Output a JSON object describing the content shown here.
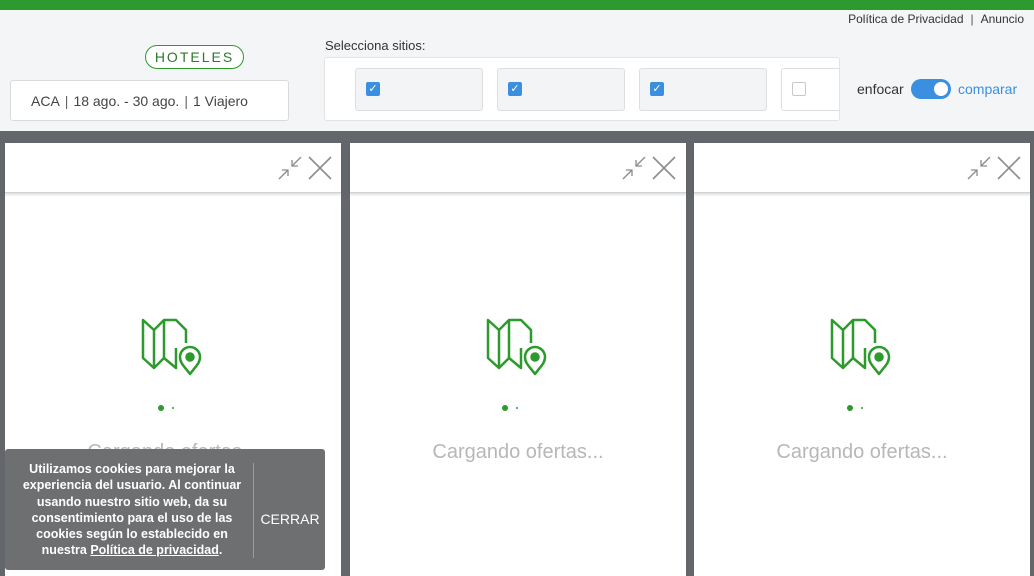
{
  "header": {
    "links": {
      "privacy": "Política de Privacidad",
      "separator": "|",
      "ad": "Anuncio"
    },
    "category_pill": "HOTELES",
    "search": {
      "destination": "ACA",
      "dates": "18 ago. - 30 ago.",
      "travelers": "1 Viajero",
      "separator": "|"
    },
    "sites_label": "Selecciona sitios:",
    "sites": [
      {
        "checked": true,
        "check_glyph": "✓"
      },
      {
        "checked": true,
        "check_glyph": "✓"
      },
      {
        "checked": true,
        "check_glyph": "✓"
      },
      {
        "checked": false
      }
    ],
    "focus_label": "enfocar",
    "toggle_on": true,
    "compare_label": "comparar"
  },
  "panels": [
    {
      "loading_text": "Cargando ofertas..."
    },
    {
      "loading_text": "Cargando ofertas..."
    },
    {
      "loading_text": "Cargando ofertas..."
    }
  ],
  "cookie_banner": {
    "text": "Utilizamos cookies para mejorar la experiencia del usuario. Al continuar usando nuestro sitio web, da su consentimiento para el uso de las cookies según lo establecido en nuestra",
    "link": "Política de privacidad",
    "period": ".",
    "close_label": "CERRAR"
  },
  "colors": {
    "brand_green": "#2c9a2c",
    "accent_blue": "#3b8fe0",
    "backdrop": "#63676b"
  },
  "icons": {
    "minimize": "compress-arrows-icon",
    "close": "close-x-icon",
    "loading": "map-pin-icon"
  }
}
